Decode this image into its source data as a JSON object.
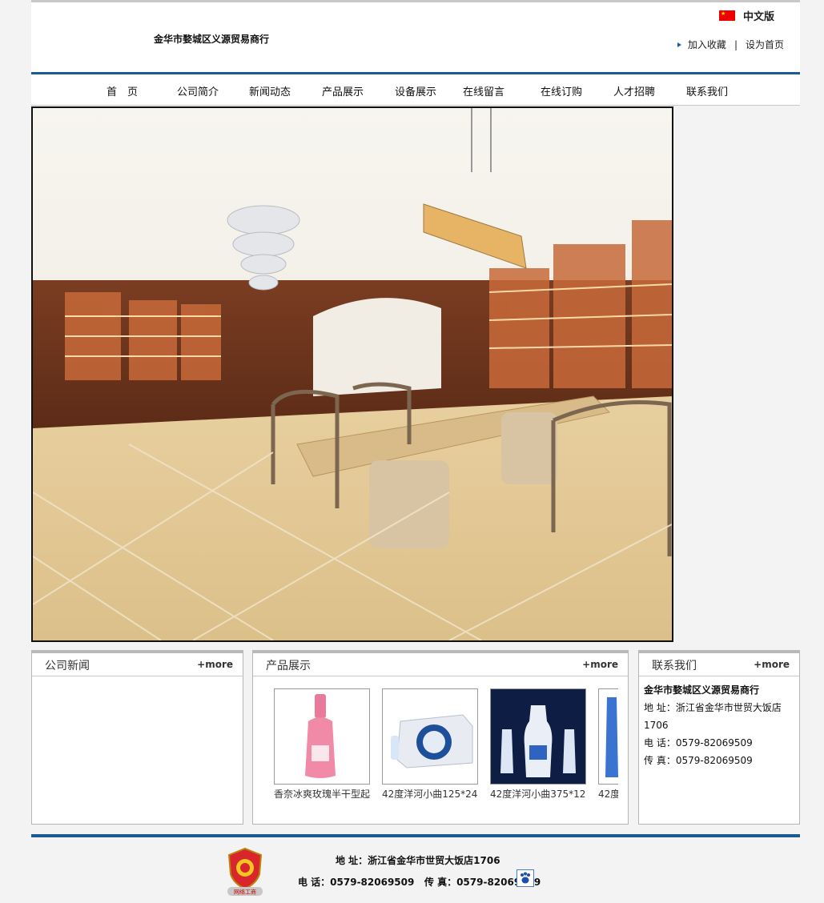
{
  "header": {
    "company_name": "金华市婺城区义源贸易商行",
    "lang_label": "中文版",
    "add_favorite": "加入收藏",
    "separator": "|",
    "set_homepage": "设为首页"
  },
  "nav": {
    "items": [
      "首　页",
      "公司简介",
      "新闻动态",
      "产品展示",
      "设备展示",
      "在线留言",
      "在线订购",
      "人才招聘",
      "联系我们"
    ]
  },
  "news": {
    "title": "公司新闻",
    "more": "+more"
  },
  "products": {
    "title": "产品展示",
    "more": "+more",
    "items": [
      {
        "caption": "香奈冰爽玫瑰半干型起"
      },
      {
        "caption": "42度洋河小曲125*24"
      },
      {
        "caption": "42度洋河小曲375*12"
      },
      {
        "caption": "42度"
      }
    ]
  },
  "contact": {
    "title": "联系我们",
    "more": "+more",
    "company": "金华市婺城区义源贸易商行",
    "address_label": "地 址：",
    "address": "浙江省金华市世贸大饭店1706",
    "tel_label": "电 话：",
    "tel": "0579-82069509",
    "fax_label": "传 真：",
    "fax": "0579-82069509"
  },
  "footer": {
    "address": "地 址：浙江省金华市世贸大饭店1706",
    "tel_fax": "电 话：0579-82069509   传 真：0579-82069509",
    "badge_text": "网络工商"
  },
  "colors": {
    "accent": "#1a5a96",
    "flag": "#ee0000"
  }
}
